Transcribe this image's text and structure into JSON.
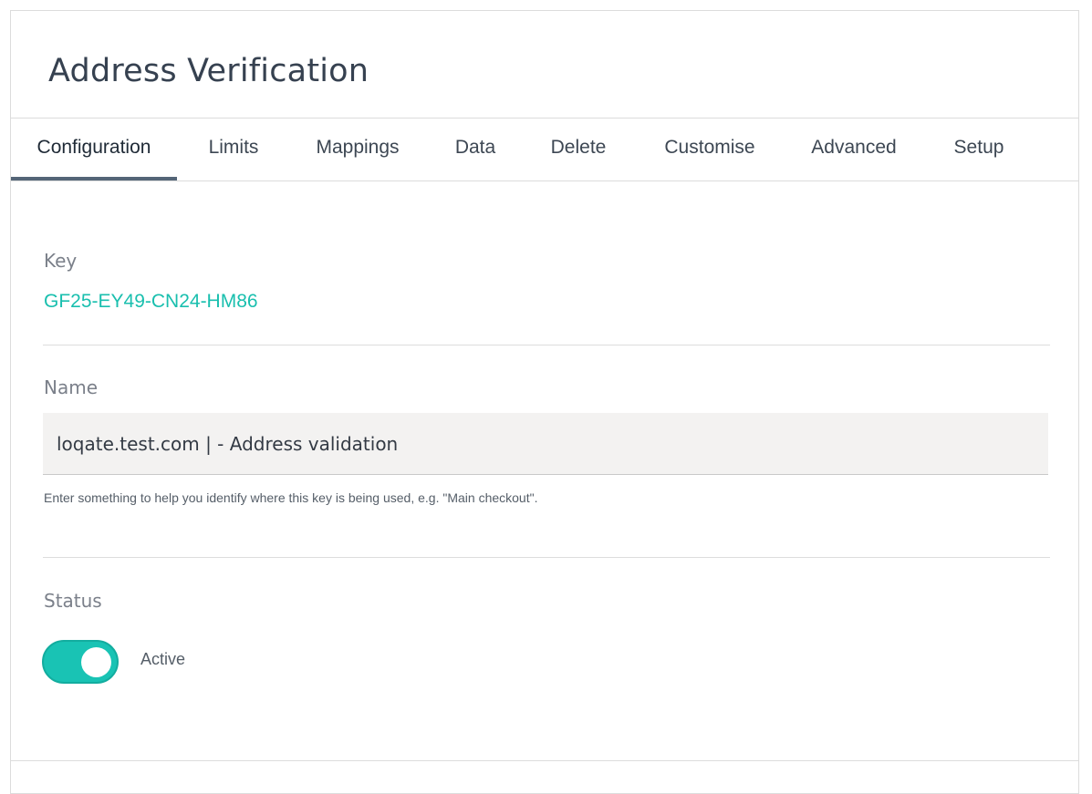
{
  "page": {
    "title": "Address Verification"
  },
  "tabs": [
    {
      "label": "Configuration",
      "active": true
    },
    {
      "label": "Limits",
      "active": false
    },
    {
      "label": "Mappings",
      "active": false
    },
    {
      "label": "Data",
      "active": false
    },
    {
      "label": "Delete",
      "active": false
    },
    {
      "label": "Customise",
      "active": false
    },
    {
      "label": "Advanced",
      "active": false
    },
    {
      "label": "Setup",
      "active": false
    }
  ],
  "key": {
    "label": "Key",
    "value": "GF25-EY49-CN24-HM86"
  },
  "name": {
    "label": "Name",
    "value": "loqate.test.com | - Address validation",
    "helper": "Enter something to help you identify where this key is being used, e.g. \"Main checkout\"."
  },
  "status": {
    "label": "Status",
    "toggle_on": true,
    "toggle_label": "Active"
  },
  "colors": {
    "accent": "#19c3b4",
    "key_text": "#19bfae",
    "title_text": "#364150",
    "active_tab_underline": "#546577",
    "input_background": "#f3f2f1"
  }
}
